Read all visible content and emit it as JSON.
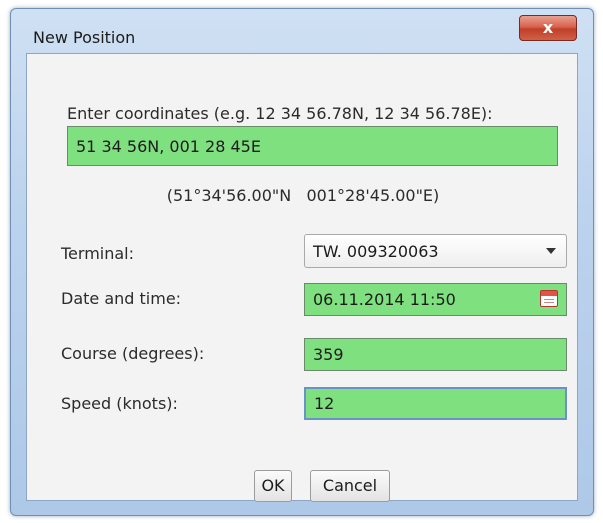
{
  "window": {
    "title": "New Position",
    "close_label": "x"
  },
  "form": {
    "coordinates": {
      "prompt": "Enter coordinates (e.g. 12 34 56.78N, 12 34 56.78E):",
      "value": "51 34 56N, 001 28 45E",
      "readout": "(51°34'56.00\"N   001°28'45.00\"E)"
    },
    "terminal": {
      "label": "Terminal:",
      "value": "TW. 009320063"
    },
    "datetime": {
      "label": "Date and time:",
      "value": "06.11.2014 11:50"
    },
    "course": {
      "label": "Course (degrees):",
      "value": "359"
    },
    "speed": {
      "label": "Speed (knots):",
      "value": "12"
    }
  },
  "buttons": {
    "ok": "OK",
    "cancel": "Cancel"
  },
  "colors": {
    "field_valid": "#7fe07f",
    "close_button": "#c23f29",
    "frame": "#bcd3ee"
  },
  "icons": {
    "dropdown": "chevron-down-icon",
    "calendar": "calendar-icon"
  }
}
